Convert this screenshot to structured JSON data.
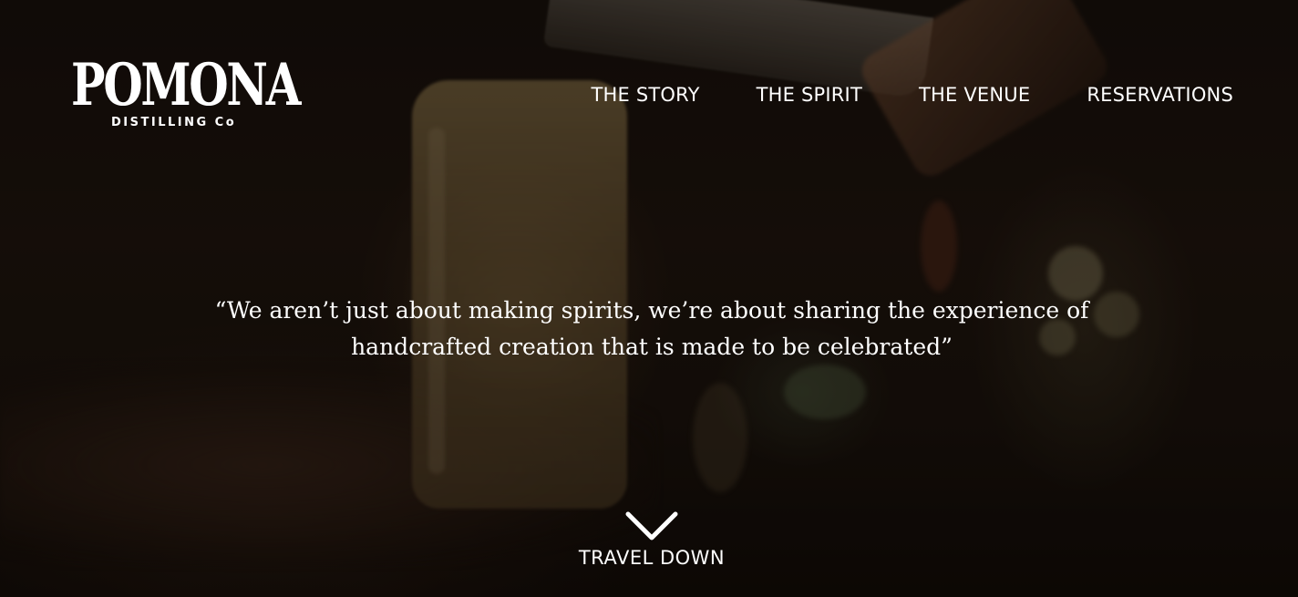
{
  "brand": {
    "name": "POMONA",
    "tagline": "DISTILLING Co"
  },
  "nav": {
    "items": [
      {
        "label": "THE STORY"
      },
      {
        "label": "THE SPIRIT"
      },
      {
        "label": "THE VENUE"
      },
      {
        "label": "RESERVATIONS"
      }
    ]
  },
  "hero": {
    "quote": "“We aren’t just about making spirits, we’re about sharing the experience of handcrafted creation that is made to be celebrated”",
    "scroll_label": "TRAVEL DOWN",
    "scroll_icon": "chevron-down-icon"
  },
  "colors": {
    "text": "#ffffff",
    "background": "#1a120c"
  }
}
